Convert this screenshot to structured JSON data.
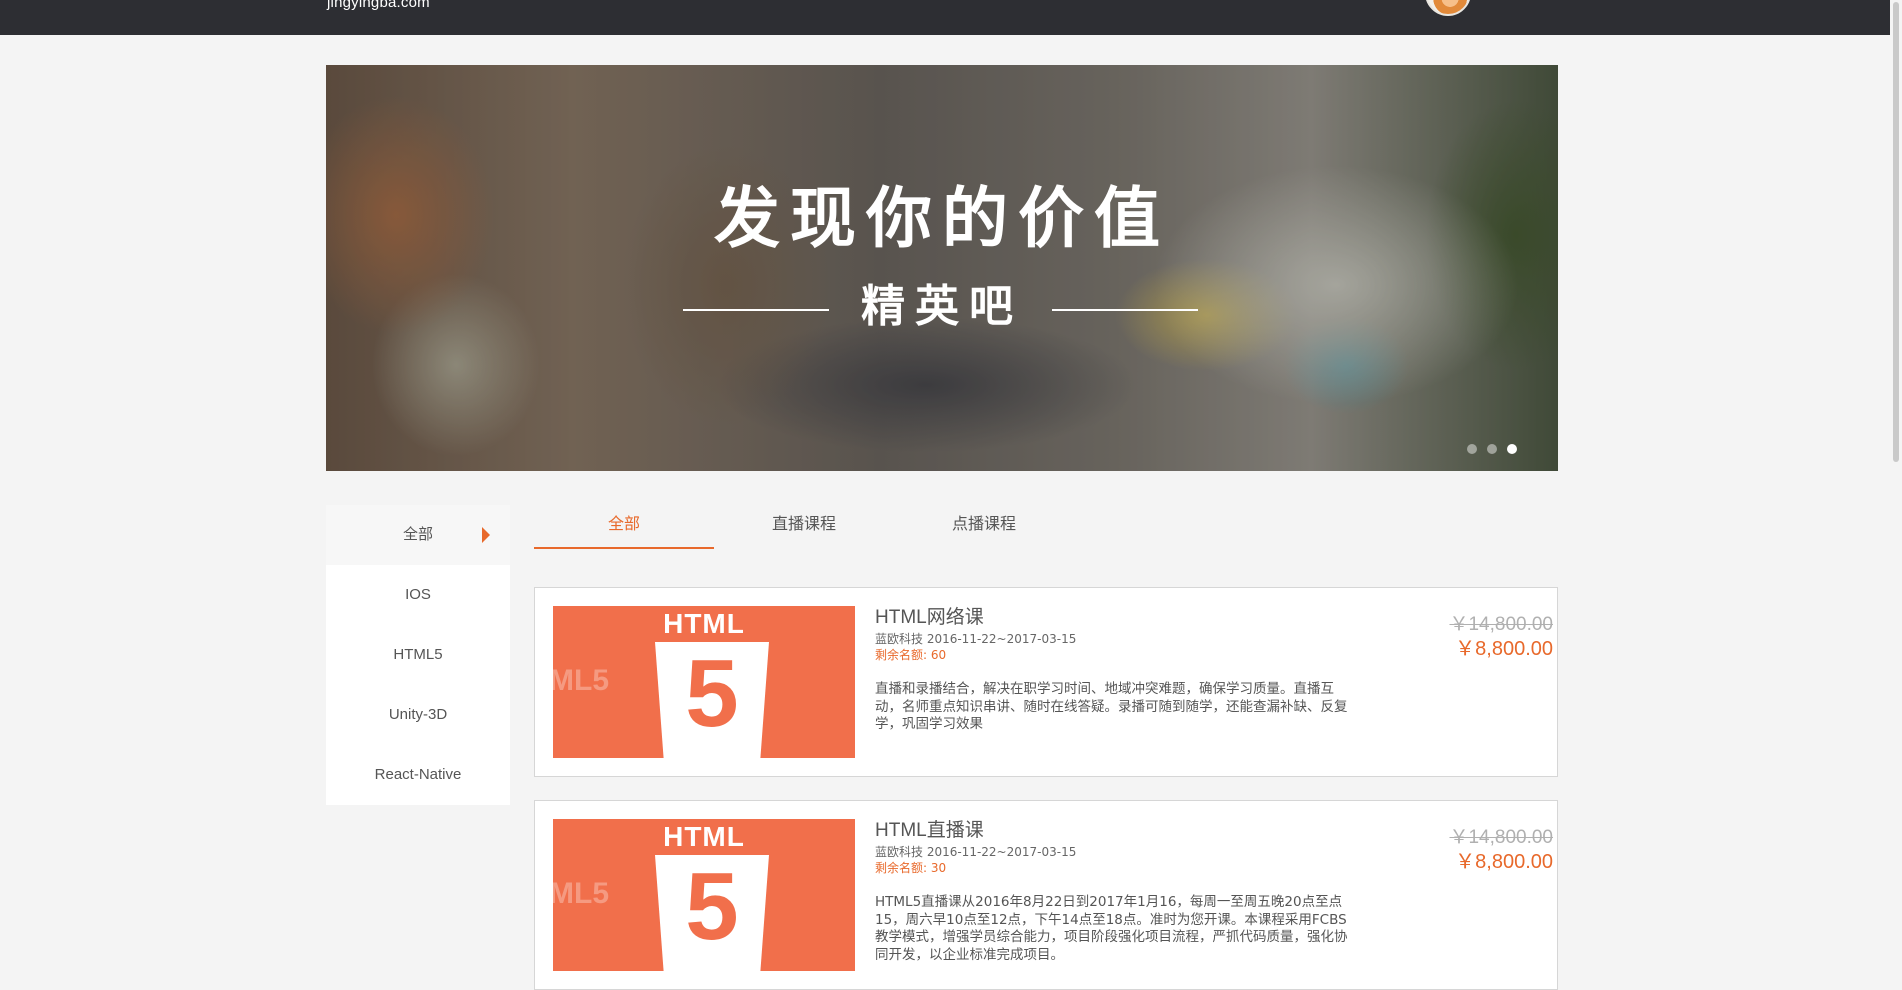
{
  "header": {
    "logo": "jingyingba.com"
  },
  "banner": {
    "title": "发现你的价值",
    "subtitle": "精英吧",
    "slide_count": 3,
    "active_slide": 3
  },
  "sidebar": {
    "items": [
      {
        "label": "全部",
        "active": true
      },
      {
        "label": "IOS"
      },
      {
        "label": "HTML5"
      },
      {
        "label": "Unity-3D"
      },
      {
        "label": "React-Native"
      }
    ]
  },
  "tabs": [
    {
      "label": "全部",
      "active": true
    },
    {
      "label": "直播课程"
    },
    {
      "label": "点播课程"
    }
  ],
  "courses": [
    {
      "thumb_text": "HTML",
      "thumb_number": "5",
      "thumb_ghost": "ML5",
      "title": "HTML网络课",
      "org_dates": "蓝欧科技 2016-11-22~2017-03-15",
      "quota": "剩余名额: 60",
      "description": "直播和录播结合，解决在职学习时间、地域冲突难题，确保学习质量。直播互动，名师重点知识串讲、随时在线答疑。录播可随到随学，还能查漏补缺、反复学，巩固学习效果",
      "old_price": "￥14,800.00",
      "price": "￥8,800.00"
    },
    {
      "thumb_text": "HTML",
      "thumb_number": "5",
      "thumb_ghost": "ML5",
      "title": "HTML直播课",
      "org_dates": "蓝欧科技 2016-11-22~2017-03-15",
      "quota": "剩余名额: 30",
      "description": "HTML5直播课从2016年8月22日到2017年1月16，每周一至周五晚20点至点15，周六早10点至12点，下午14点至18点。准时为您开课。本课程采用FCBS 教学模式，增强学员综合能力，项目阶段强化项目流程，严抓代码质量，强化协同开发，以企业标准完成项目。",
      "old_price": "￥14,800.00",
      "price": "￥8,800.00"
    }
  ],
  "colors": {
    "accent": "#e8692b",
    "header_bg": "#2d2e33",
    "thumb_bg": "#f16f4b"
  }
}
